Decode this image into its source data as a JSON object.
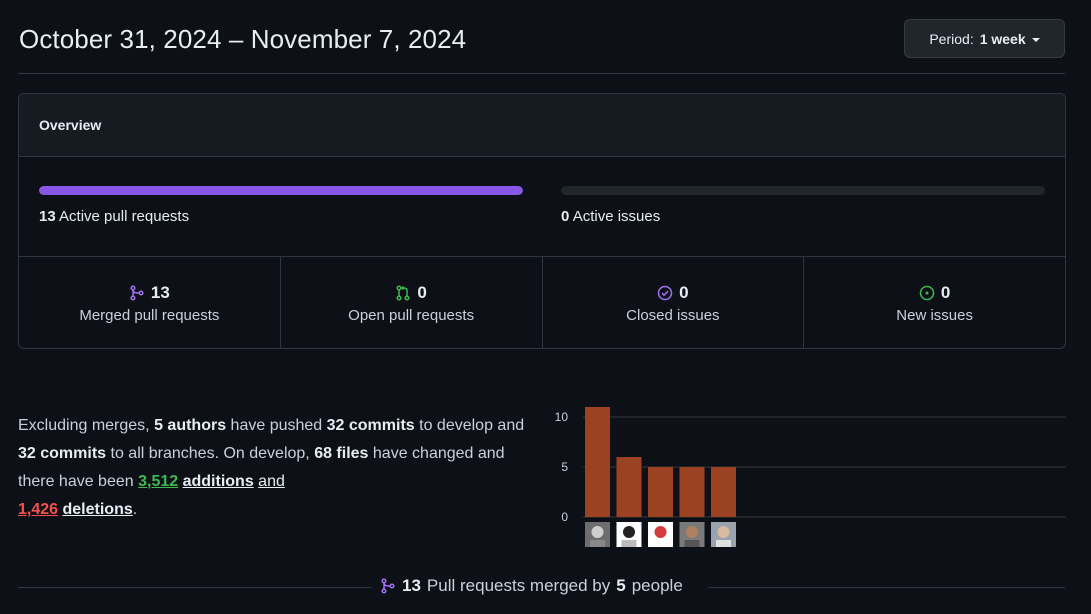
{
  "header": {
    "date_range": "October 31, 2024 – November 7, 2024",
    "period_prefix": "Period:",
    "period_value": "1 week"
  },
  "overview": {
    "title": "Overview",
    "active_prs": {
      "count": "13",
      "label": "Active pull requests",
      "fill": 1.0
    },
    "active_issues": {
      "count": "0",
      "label": "Active issues",
      "fill": 0.0
    },
    "stats": [
      {
        "icon": "git-merge-icon",
        "count": "13",
        "label": "Merged pull requests",
        "color": "#a371f7"
      },
      {
        "icon": "git-pull-request-icon",
        "count": "0",
        "label": "Open pull requests",
        "color": "#3fb950"
      },
      {
        "icon": "issue-closed-icon",
        "count": "0",
        "label": "Closed issues",
        "color": "#a371f7"
      },
      {
        "icon": "issue-opened-icon",
        "count": "0",
        "label": "New issues",
        "color": "#3fb950"
      }
    ]
  },
  "summary": {
    "p1": "Excluding merges,",
    "authors": "5 authors",
    "p2": "have pushed",
    "commits1": "32 commits",
    "p3": "to develop and",
    "commits2": "32 commits",
    "p4": "to all branches. On develop,",
    "files": "68 files",
    "p5": "have changed and there have been",
    "additions_num": "3,512",
    "additions_word": "additions",
    "p6": "and",
    "deletions_num": "1,426",
    "deletions_word": "deletions",
    "p7": "."
  },
  "chart_data": {
    "type": "bar",
    "categories": [
      "author1",
      "author2",
      "author3",
      "author4",
      "author5"
    ],
    "values": [
      11,
      6,
      5,
      5,
      5
    ],
    "yticks": [
      0,
      5,
      10
    ],
    "ylim": [
      0,
      12
    ],
    "bar_color": "#9b4222"
  },
  "footer": {
    "count": "13",
    "text1": "Pull requests merged by",
    "people": "5",
    "text2": "people"
  }
}
